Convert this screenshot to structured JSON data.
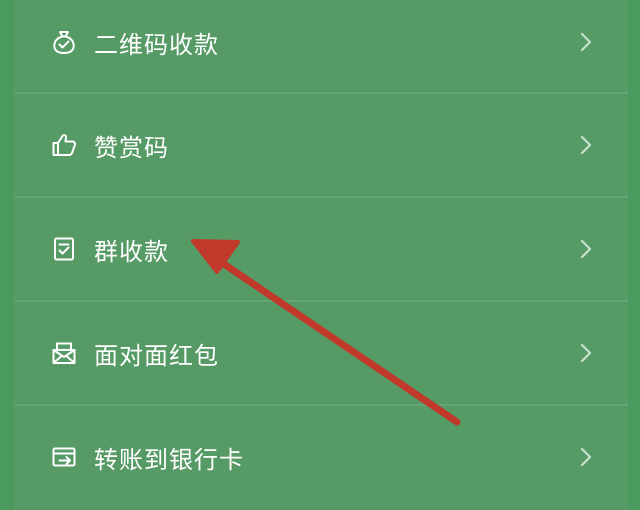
{
  "menu": {
    "items": [
      {
        "icon": "money-bag-icon",
        "label": "二维码收款"
      },
      {
        "icon": "thumbs-up-icon",
        "label": "赞赏码"
      },
      {
        "icon": "group-receipt-icon",
        "label": "群收款"
      },
      {
        "icon": "red-envelope-icon",
        "label": "面对面红包"
      },
      {
        "icon": "bank-transfer-icon",
        "label": "转账到银行卡"
      }
    ]
  },
  "colors": {
    "background": "#4a9a5f",
    "panel": "#569a66",
    "text": "#ffffff",
    "annotation_arrow": "#c0392b"
  }
}
